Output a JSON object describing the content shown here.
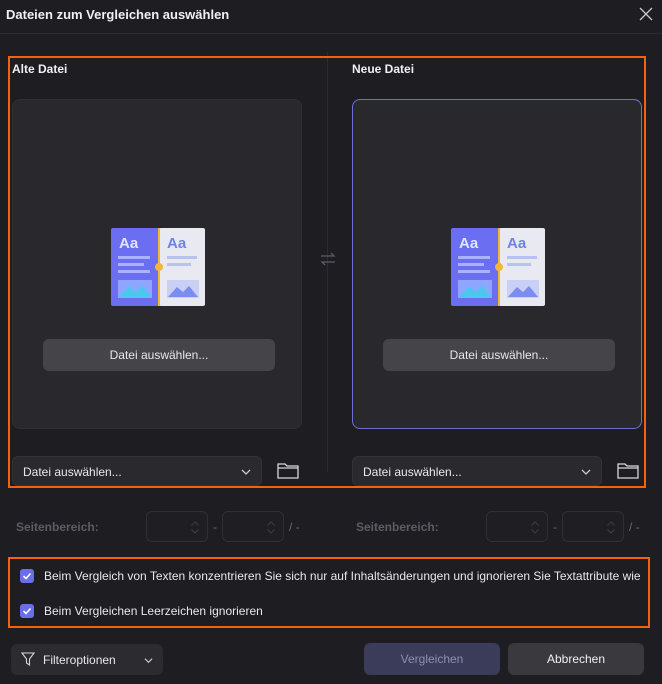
{
  "window": {
    "title": "Dateien zum Vergleichen auswählen"
  },
  "left": {
    "label": "Alte Datei",
    "pick_button": "Datei auswählen...",
    "combo_value": "Datei auswählen...",
    "range_label": "Seitenbereich:",
    "range_sep": "-",
    "range_end": "/ -"
  },
  "right": {
    "label": "Neue Datei",
    "pick_button": "Datei auswählen...",
    "combo_value": "Datei auswählen...",
    "range_label": "Seitenbereich:",
    "range_sep": "-",
    "range_end": "/ -"
  },
  "options": [
    {
      "label": "Beim Vergleich von Texten konzentrieren Sie sich nur auf Inhaltsänderungen und ignorieren Sie Textattribute wie Schriftart, Farbe usw.",
      "checked": true
    },
    {
      "label": "Beim Vergleichen Leerzeichen ignorieren",
      "checked": true
    }
  ],
  "footer": {
    "filter_label": "Filteroptionen",
    "compare_label": "Vergleichen",
    "cancel_label": "Abbrechen"
  },
  "colors": {
    "accent": "#6a6ee8",
    "highlight": "#f2620f",
    "background": "#1e1d21"
  }
}
